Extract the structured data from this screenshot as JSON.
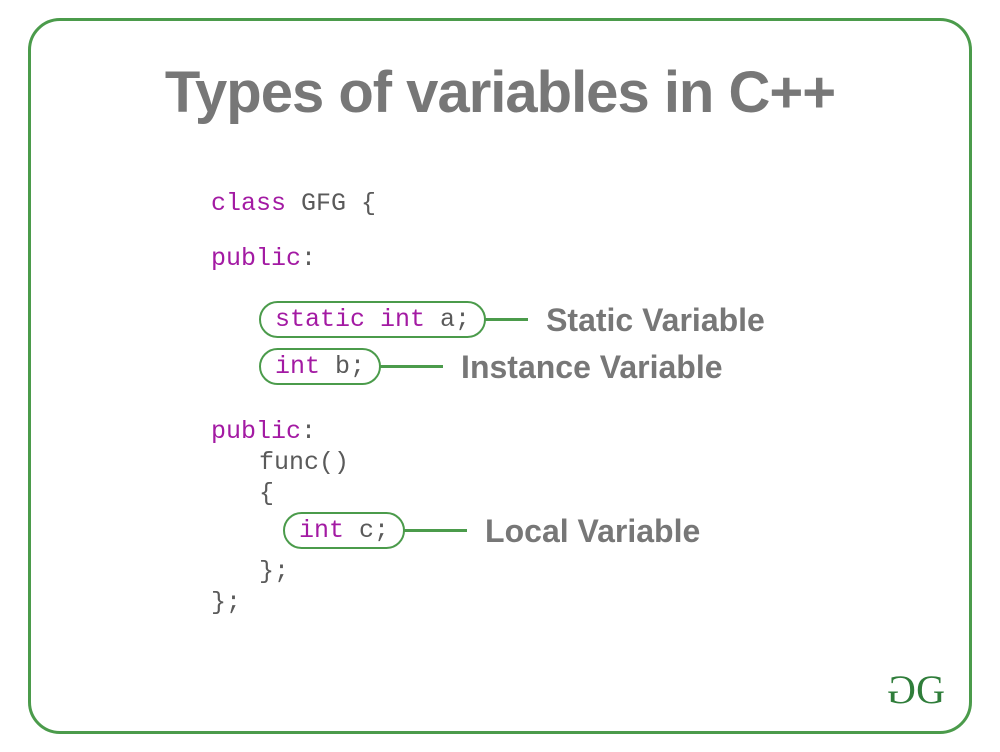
{
  "title": "Types of variables in C++",
  "code": {
    "line1_kw": "class",
    "line1_rest": "GFG {",
    "public_label": "public",
    "static_kw": "static int",
    "var_a": "a;",
    "int_kw": "int",
    "var_b": "b;",
    "func_text": "func()",
    "brace_open": "{",
    "var_c": "c;",
    "brace_close_semi": "};",
    "brace_close_semi2": "};"
  },
  "annotations": {
    "static": "Static Variable",
    "instance": "Instance Variable",
    "local": "Local Variable"
  },
  "logo": {
    "g1": "G",
    "g2": "G"
  }
}
